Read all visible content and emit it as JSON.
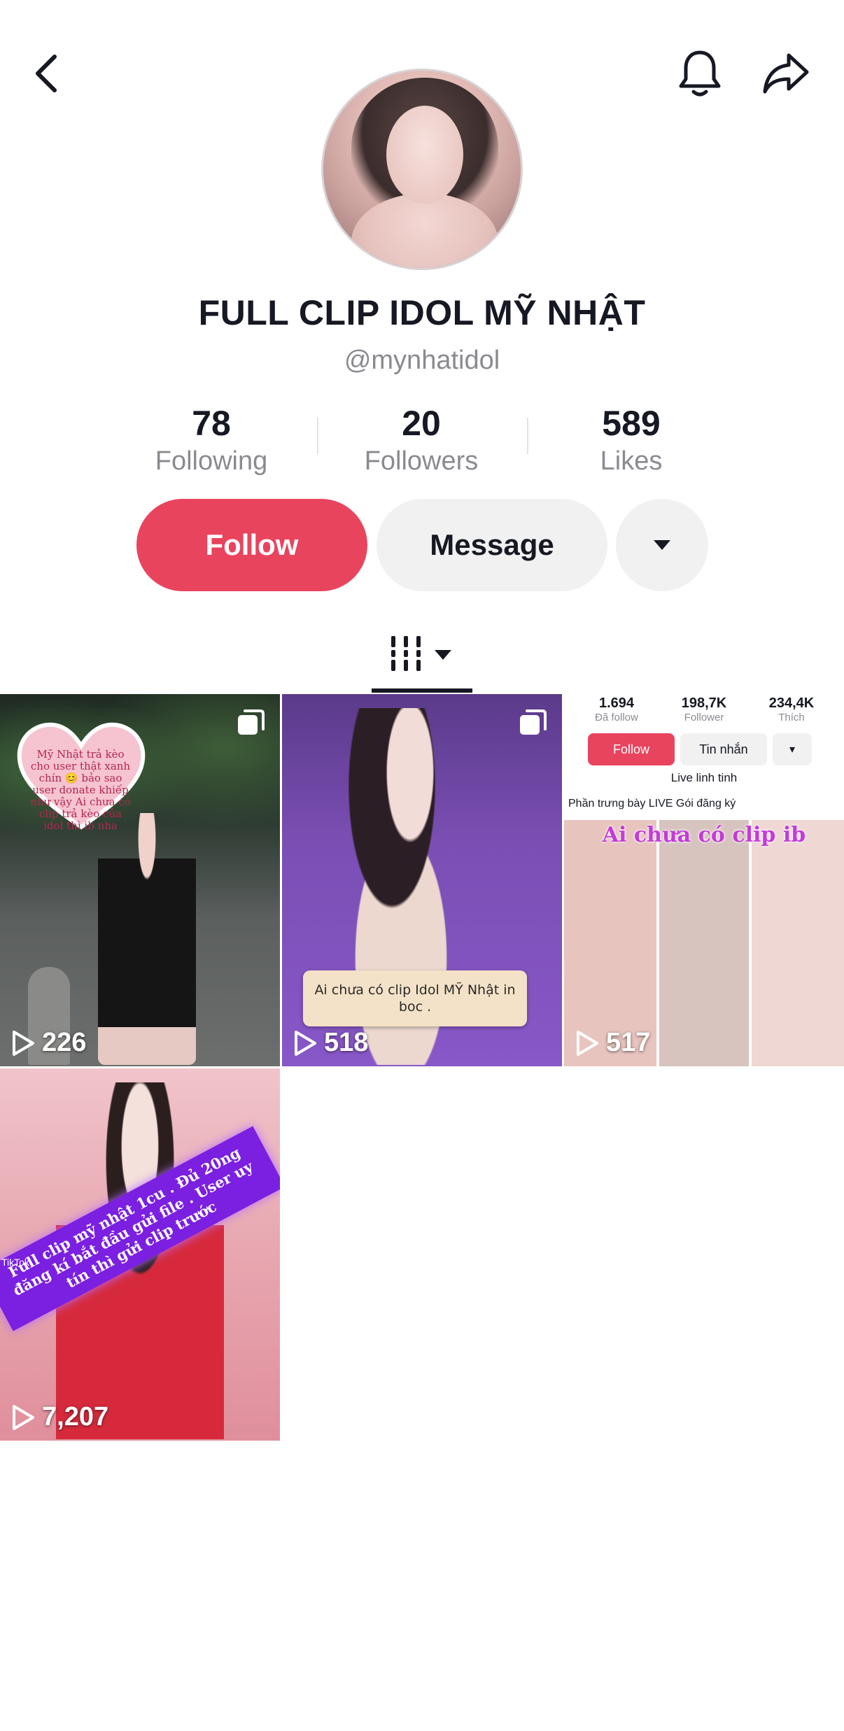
{
  "profile": {
    "name": "FULL CLIP IDOL MỸ NHẬT",
    "username": "@mynhatidol"
  },
  "stats": {
    "following": {
      "value": "78",
      "label": "Following"
    },
    "followers": {
      "value": "20",
      "label": "Followers"
    },
    "likes": {
      "value": "589",
      "label": "Likes"
    }
  },
  "actions": {
    "follow_label": "Follow",
    "message_label": "Message"
  },
  "icons": {
    "back": "chevron-left-icon",
    "bell": "bell-icon",
    "share": "share-icon",
    "more": "caret-down-icon",
    "videos_tab": "grid-icon"
  },
  "colors": {
    "accent": "#e9445e",
    "text": "#161823",
    "muted": "#8a8b91",
    "button_bg": "#f1f1f2"
  },
  "videos": [
    {
      "plays": "226",
      "multi": true,
      "overlay_text": "Mỹ Nhật trả kèo cho user thật xanh chín 😊 bảo sao user donate khiếp như vậy Ai chưa có clip trả kèo của idol thì ib nha"
    },
    {
      "plays": "518",
      "multi": true,
      "overlay_text": "Ai chưa có clip Idol MỸ Nhật in boc ."
    },
    {
      "plays": "517",
      "multi": false,
      "mini_profile": {
        "stats": [
          {
            "value": "1.694",
            "label": "Đã follow"
          },
          {
            "value": "198,7K",
            "label": "Follower"
          },
          {
            "value": "234,4K",
            "label": "Thích"
          }
        ],
        "follow": "Follow",
        "message": "Tin nhắn",
        "bio": "Live linh tinh",
        "row": "Phần trưng bày  LIVE  Gói đăng ký",
        "banner": "Ai chưa có clip ib"
      }
    },
    {
      "plays": "7,207",
      "multi": false,
      "overlay_text": "Full clip mỹ nhật 1cu . Đủ 20ng đăng kí bắt đầu gửi file . User uy tín thì gửi clip trước",
      "watermark": "TikTok"
    }
  ]
}
